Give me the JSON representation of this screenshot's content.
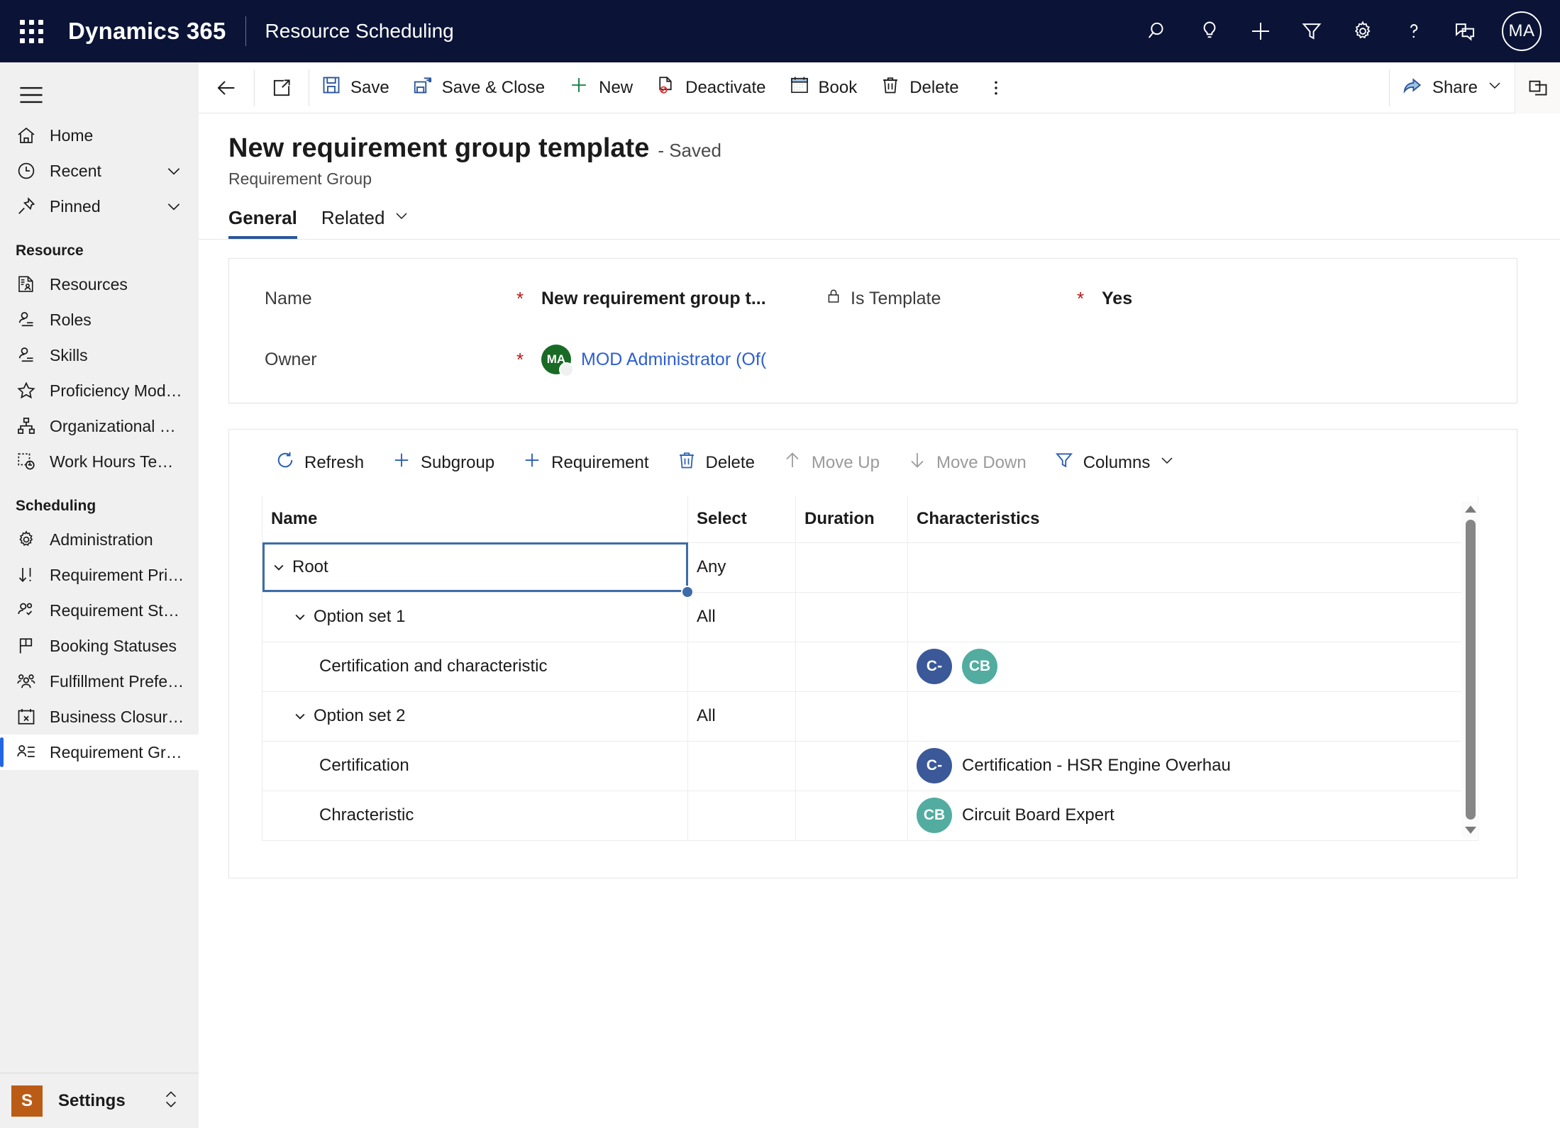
{
  "header": {
    "brand": "Dynamics 365",
    "app_name": "Resource Scheduling",
    "avatar_initials": "MA",
    "icons": [
      {
        "name": "search-icon",
        "label": "Search"
      },
      {
        "name": "lightbulb-icon",
        "label": "Insights"
      },
      {
        "name": "plus-icon",
        "label": "Quick create"
      },
      {
        "name": "filter-icon",
        "label": "Filter"
      },
      {
        "name": "gear-icon",
        "label": "Settings"
      },
      {
        "name": "question-icon",
        "label": "Help"
      },
      {
        "name": "feedback-icon",
        "label": "Feedback"
      }
    ]
  },
  "sidebar": {
    "hamburger_label": "Site map",
    "top_items": [
      {
        "label": "Home",
        "icon": "home-icon",
        "chevron": false
      },
      {
        "label": "Recent",
        "icon": "clock-icon",
        "chevron": true
      },
      {
        "label": "Pinned",
        "icon": "pin-icon",
        "chevron": true
      }
    ],
    "groups": [
      {
        "title": "Resource",
        "items": [
          {
            "label": "Resources",
            "icon": "resource-card-icon"
          },
          {
            "label": "Roles",
            "icon": "person-line-icon"
          },
          {
            "label": "Skills",
            "icon": "person-line-icon"
          },
          {
            "label": "Proficiency Models",
            "icon": "star-icon"
          },
          {
            "label": "Organizational Units",
            "icon": "org-chart-icon"
          },
          {
            "label": "Work Hours Templates",
            "icon": "dotted-clock-icon"
          }
        ]
      },
      {
        "title": "Scheduling",
        "items": [
          {
            "label": "Administration",
            "icon": "gear-icon"
          },
          {
            "label": "Requirement Priorities",
            "icon": "sort-down-icon"
          },
          {
            "label": "Requirement Statuses",
            "icon": "people-check-icon"
          },
          {
            "label": "Booking Statuses",
            "icon": "flag-icon"
          },
          {
            "label": "Fulfillment Preferences",
            "icon": "people-group-icon"
          },
          {
            "label": "Business Closures",
            "icon": "calendar-x-icon"
          },
          {
            "label": "Requirement Group ...",
            "icon": "person-list-icon",
            "selected": true
          }
        ]
      }
    ],
    "footer": {
      "tile": "S",
      "label": "Settings",
      "chevron_icon": "expand-updown-icon"
    }
  },
  "commandbar": {
    "back_icon": "back-arrow-icon",
    "popout_icon": "open-in-new-icon",
    "buttons": [
      {
        "label": "Save",
        "icon": "save-icon"
      },
      {
        "label": "Save & Close",
        "icon": "save-close-icon"
      },
      {
        "label": "New",
        "icon": "plus-icon"
      },
      {
        "label": "Deactivate",
        "icon": "deactivate-icon"
      },
      {
        "label": "Book",
        "icon": "calendar-icon"
      },
      {
        "label": "Delete",
        "icon": "trash-icon"
      }
    ],
    "overflow_icon": "more-vertical-icon",
    "share": {
      "label": "Share",
      "icon": "share-icon",
      "chevron": "chevron-down-icon"
    },
    "right_panel_icon": "side-panel-icon"
  },
  "record": {
    "title": "New requirement group template",
    "saved_state": "- Saved",
    "entity": "Requirement Group",
    "tabs": [
      {
        "label": "General",
        "active": true,
        "chevron": false
      },
      {
        "label": "Related",
        "active": false,
        "chevron": true
      }
    ]
  },
  "form": {
    "fields": [
      {
        "label": "Name",
        "required": "*",
        "value": "New requirement group t...",
        "lock_icon": false
      },
      {
        "label": "Is Template",
        "required": "*",
        "value": "Yes",
        "lock_icon": true
      },
      {
        "label": "Owner",
        "required": "*",
        "value": "MOD Administrator (Of(",
        "avatar": "MA",
        "is_link": true
      }
    ]
  },
  "grid": {
    "toolbar": [
      {
        "label": "Refresh",
        "icon": "refresh-icon",
        "disabled": false
      },
      {
        "label": "Subgroup",
        "icon": "plus-icon",
        "disabled": false
      },
      {
        "label": "Requirement",
        "icon": "plus-icon",
        "disabled": false
      },
      {
        "label": "Delete",
        "icon": "trash-icon",
        "disabled": false
      },
      {
        "label": "Move Up",
        "icon": "arrow-up-icon",
        "disabled": true
      },
      {
        "label": "Move Down",
        "icon": "arrow-down-icon",
        "disabled": true
      },
      {
        "label": "Columns",
        "icon": "filter-icon",
        "disabled": false,
        "chevron": true
      }
    ],
    "columns": [
      "Name",
      "Select",
      "Duration",
      "Characteristics"
    ],
    "rows": [
      {
        "name": "Root",
        "indent": 0,
        "expandable": true,
        "select": "Any",
        "duration": "",
        "characteristics": [],
        "selected": true
      },
      {
        "name": "Option set 1",
        "indent": 1,
        "expandable": true,
        "select": "All",
        "duration": "",
        "characteristics": [],
        "selected": false
      },
      {
        "name": "Certification and characteristic",
        "indent": 2,
        "expandable": false,
        "select": "",
        "duration": "",
        "characteristics": [
          {
            "initials": "C-",
            "color": "#3b5998",
            "label": ""
          },
          {
            "initials": "CB",
            "color": "#52aca0",
            "label": ""
          }
        ],
        "selected": false
      },
      {
        "name": "Option set 2",
        "indent": 1,
        "expandable": true,
        "select": "All",
        "duration": "",
        "characteristics": [],
        "selected": false
      },
      {
        "name": "Certification",
        "indent": 2,
        "expandable": false,
        "select": "",
        "duration": "",
        "characteristics": [
          {
            "initials": "C-",
            "color": "#3b5998",
            "label": "Certification - HSR Engine Overhau"
          }
        ],
        "selected": false
      },
      {
        "name": "Chracteristic",
        "indent": 2,
        "expandable": false,
        "select": "",
        "duration": "",
        "characteristics": [
          {
            "initials": "CB",
            "color": "#52aca0",
            "label": "Circuit Board Expert"
          }
        ],
        "selected": false
      }
    ],
    "scrollbar": {
      "up_icon": "scroll-up-arrow",
      "down_icon": "scroll-down-arrow"
    }
  },
  "colors": {
    "header_bg": "#0b1437",
    "accent": "#2266e3",
    "required_star": "#b81b1b",
    "link": "#2e5fd0",
    "settings_tile": "#bb5c16",
    "owner_avatar": "#186a25",
    "tab_underline": "#2b579a"
  }
}
